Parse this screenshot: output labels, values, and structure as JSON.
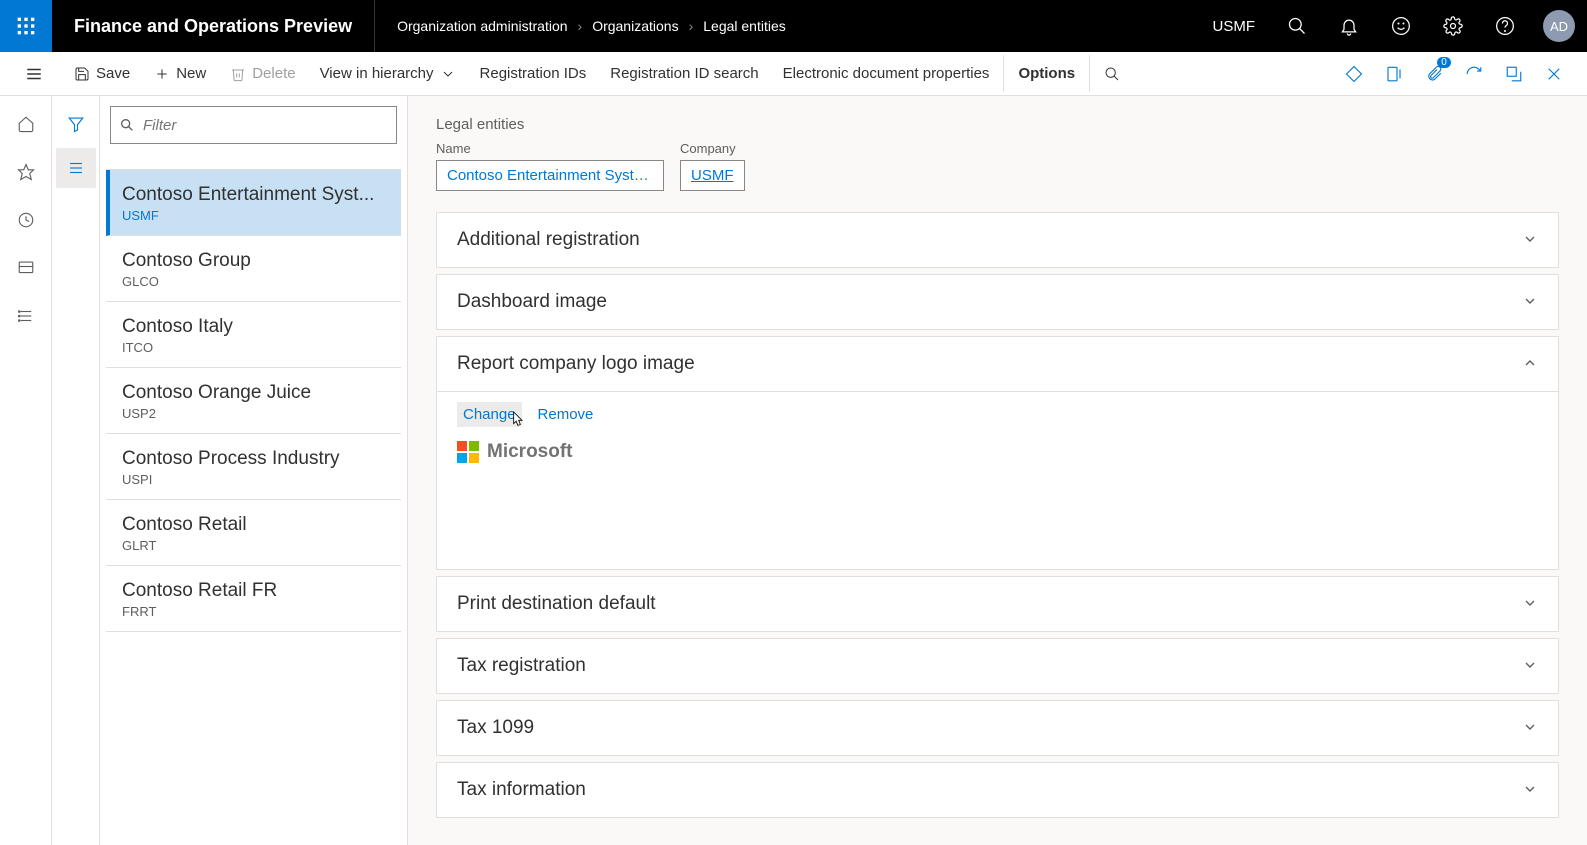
{
  "app_title": "Finance and Operations Preview",
  "breadcrumb": [
    "Organization administration",
    "Organizations",
    "Legal entities"
  ],
  "company_context": "USMF",
  "avatar_initials": "AD",
  "actions": {
    "save": "Save",
    "new": "New",
    "delete": "Delete",
    "view_hierarchy": "View in hierarchy",
    "registration_ids": "Registration IDs",
    "registration_id_search": "Registration ID search",
    "edoc_props": "Electronic document properties",
    "options": "Options"
  },
  "attach_badge": "0",
  "filter_placeholder": "Filter",
  "entities": [
    {
      "name": "Contoso Entertainment Syst...",
      "code": "USMF",
      "selected": true
    },
    {
      "name": "Contoso Group",
      "code": "GLCO"
    },
    {
      "name": "Contoso Italy",
      "code": "ITCO"
    },
    {
      "name": "Contoso Orange Juice",
      "code": "USP2"
    },
    {
      "name": "Contoso Process Industry",
      "code": "USPI"
    },
    {
      "name": "Contoso Retail",
      "code": "GLRT"
    },
    {
      "name": "Contoso Retail FR",
      "code": "FRRT"
    }
  ],
  "form": {
    "caption": "Legal entities",
    "labels": {
      "name": "Name",
      "company": "Company"
    },
    "values": {
      "name": "Contoso Entertainment System ...",
      "company": "USMF"
    }
  },
  "panels": {
    "addl_reg": "Additional registration",
    "dashboard_img": "Dashboard image",
    "report_logo": "Report company logo image",
    "print_dest": "Print destination default",
    "tax_reg": "Tax registration",
    "tax_1099": "Tax 1099",
    "tax_info": "Tax information"
  },
  "logo": {
    "change": "Change",
    "remove": "Remove",
    "brand": "Microsoft"
  }
}
